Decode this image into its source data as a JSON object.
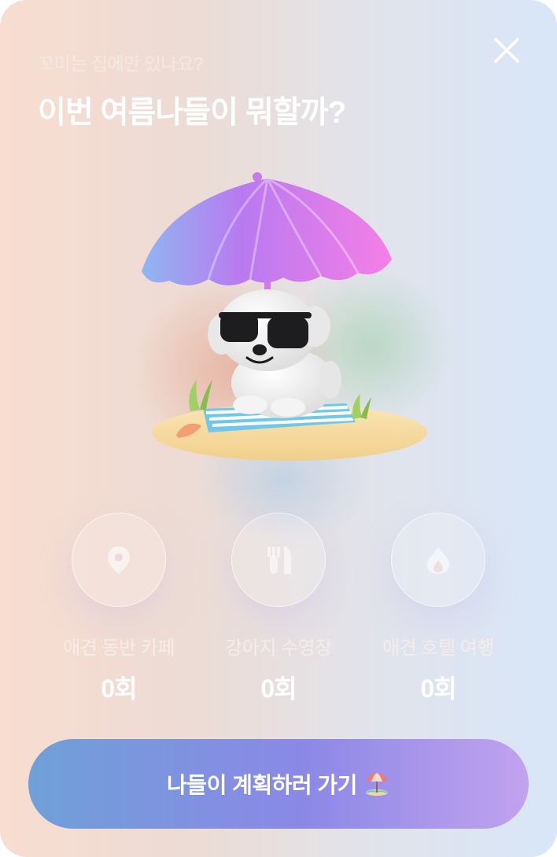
{
  "header": {
    "subtitle": "꼬미는 집에만 있나요?",
    "title": "이번 여름나들이 뭐할까?"
  },
  "close_icon": "close-icon",
  "illustration": "dog-under-beach-umbrella",
  "stats": [
    {
      "icon": "location-pin-icon",
      "label": "애견 동반 카페",
      "value": "0회"
    },
    {
      "icon": "fork-knife-icon",
      "label": "강아지 수영장",
      "value": "0회"
    },
    {
      "icon": "flame-icon",
      "label": "애견 호텔 여행",
      "value": "0회"
    }
  ],
  "cta": {
    "label": "나들이 계획하러 가기",
    "emoji_icon": "beach-umbrella-icon"
  },
  "colors": {
    "cta_start": "#6fa0d8",
    "cta_end": "#c2a2ef",
    "background_left": "#f8ddd0",
    "background_right": "#d8e6f8"
  }
}
